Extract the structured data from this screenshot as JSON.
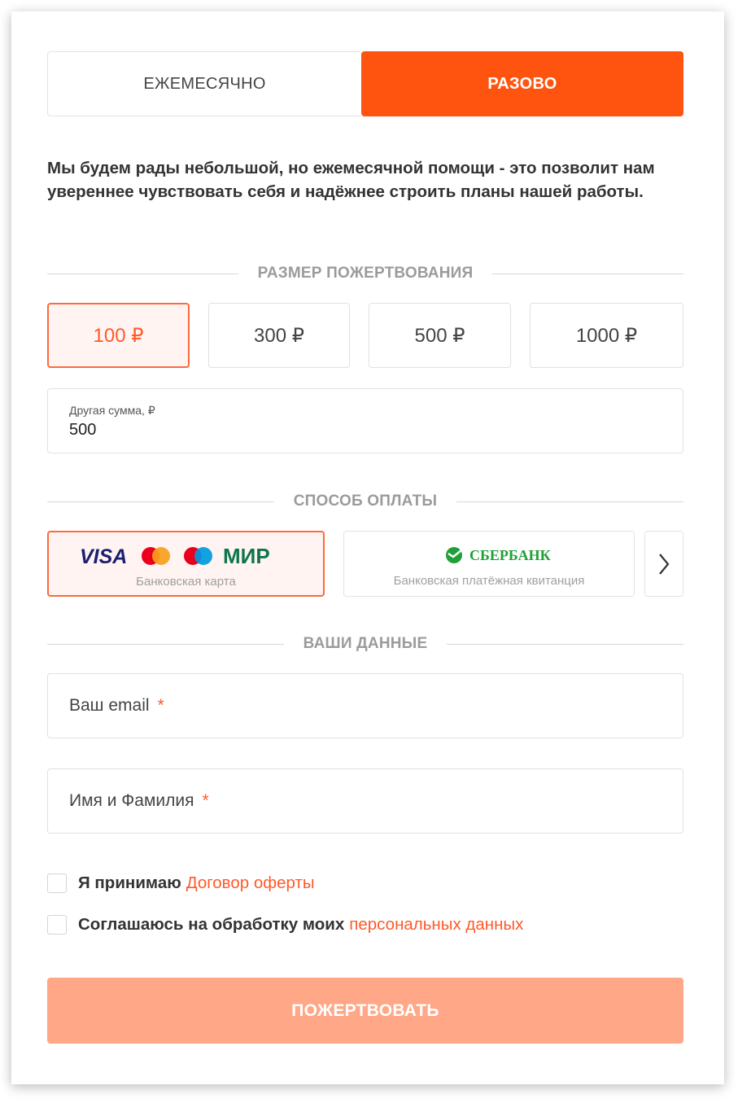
{
  "tabs": {
    "monthly": "ЕЖЕМЕСЯЧНО",
    "once": "РАЗОВО",
    "active": "once"
  },
  "description": "Мы будем рады небольшой, но ежемесячной помощи - это позволит нам увереннее чувствовать себя и надёжнее строить планы нашей работы.",
  "donation": {
    "section_label": "РАЗМЕР ПОЖЕРТВОВАНИЯ",
    "amounts": [
      "100 ₽",
      "300 ₽",
      "500 ₽",
      "1000 ₽"
    ],
    "selected_amount": "100 ₽",
    "other_label": "Другая сумма, ₽",
    "other_value": "500"
  },
  "payment": {
    "section_label": "СПОСОБ ОПЛАТЫ",
    "methods": [
      {
        "logos": [
          "VISA",
          "Mastercard",
          "Maestro",
          "МИР"
        ],
        "label": "Банковская карта",
        "selected": true
      },
      {
        "logos": [
          "СБЕРБАНК"
        ],
        "label": "Банковская платёжная квитанция",
        "selected": false
      }
    ]
  },
  "user": {
    "section_label": "ВАШИ ДАННЫЕ",
    "email_placeholder": "Ваш email",
    "name_placeholder": "Имя и Фамилия",
    "required_mark": "*"
  },
  "agreements": [
    {
      "text": "Я принимаю",
      "link": "Договор оферты"
    },
    {
      "text": "Соглашаюсь на обработку моих",
      "link": "персональных данных"
    }
  ],
  "submit_label": "ПОЖЕРТВОВАТЬ",
  "colors": {
    "accent": "#ff5410",
    "selected_border": "#ff6a3d",
    "selected_bg": "#fff4f1",
    "link": "#ff5a2a",
    "submit_bg": "#ffa787",
    "visa": "#1a1f71",
    "mc_red": "#eb001b",
    "mc_orange": "#f79e1b",
    "maestro_blue": "#0099df",
    "mir_green": "#0f754e",
    "sber_green": "#21a038"
  }
}
